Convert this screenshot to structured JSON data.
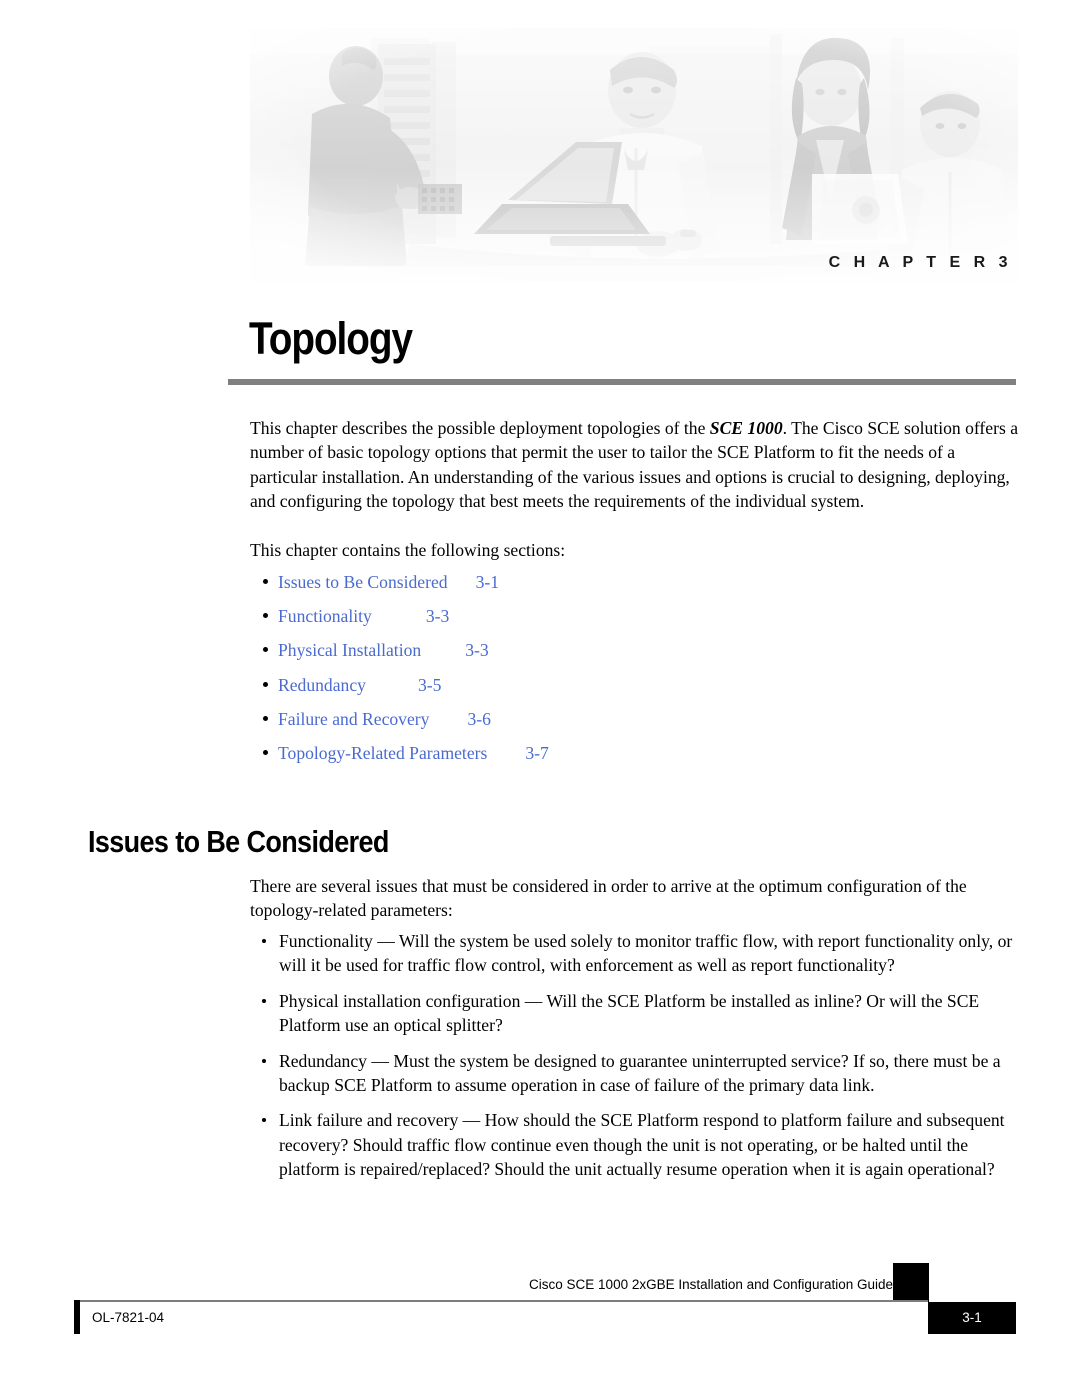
{
  "header": {
    "chapter_label": "C H A P T E R   3",
    "banner_alt": "grayscale-photo-people-at-conference-table-with-laptop"
  },
  "chapter": {
    "title": "Topology"
  },
  "intro": {
    "paragraph": "This chapter describes the possible deployment topologies of the SCE 1000. The Cisco SCE solution offers a number of basic topology options that permit the user to tailor the SCE Platform to fit the needs of a particular installation. An understanding of the various issues and options is crucial to designing, deploying, and configuring the topology that best meets the requirements of the individual system.",
    "sections_lead": "This chapter contains the following sections:"
  },
  "toc": {
    "items": [
      {
        "label": "Issues to Be Considered",
        "page": "3-1",
        "gap": 28
      },
      {
        "label": "Functionality",
        "page": "3-3",
        "gap": 54
      },
      {
        "label": "Physical Installation",
        "page": "3-3",
        "gap": 44
      },
      {
        "label": "Redundancy",
        "page": "3-5",
        "gap": 52
      },
      {
        "label": "Failure and Recovery",
        "page": "3-6",
        "gap": 38
      },
      {
        "label": "Topology-Related Parameters",
        "page": "3-7",
        "gap": 38
      }
    ]
  },
  "section": {
    "heading": "Issues to Be Considered",
    "intro": "There are several issues that must be considered in order to arrive at the optimum configuration of the topology-related parameters:",
    "bullets": [
      "Functionality — Will the system be used solely to monitor traffic flow, with report functionality only, or will it be used for traffic flow control, with enforcement as well as report functionality?",
      "Physical installation configuration — Will the SCE Platform be installed as inline? Or will the SCE Platform use an optical splitter?",
      "Redundancy — Must the system be designed to guarantee uninterrupted service? If so, there must be a backup SCE Platform to assume operation in case of failure of the primary data link.",
      "Link failure and recovery — How should the SCE Platform respond to platform failure and subsequent recovery? Should traffic flow continue even though the unit is not operating, or be halted until the platform is repaired/replaced? Should the unit actually resume operation when it is again operational?"
    ]
  },
  "footer": {
    "guide_title": "Cisco SCE 1000 2xGBE Installation and Configuration Guide",
    "doc_id": "OL-7821-04",
    "page_number": "3-1"
  },
  "colors": {
    "link_blue": "#4a6ad0",
    "rule_gray": "#808080",
    "tab_black": "#000000"
  }
}
